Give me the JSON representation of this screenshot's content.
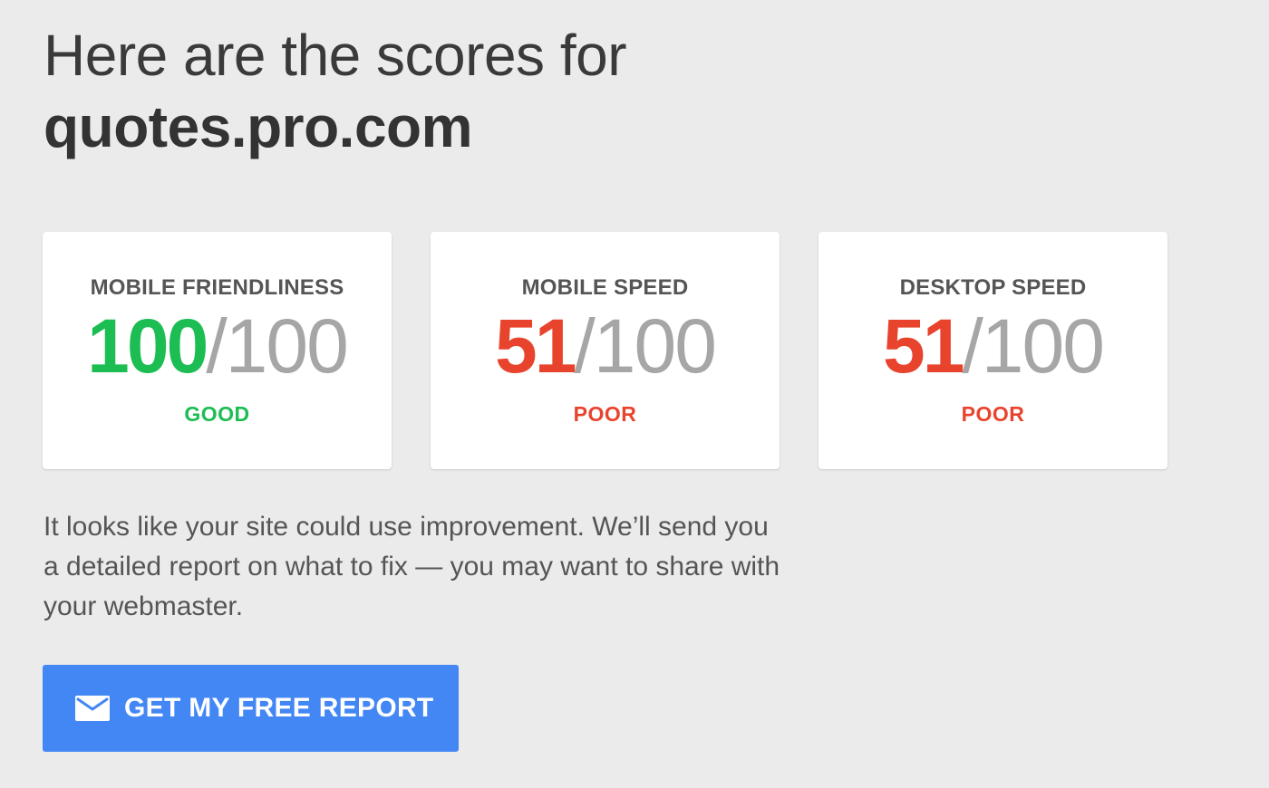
{
  "header": {
    "line1": "Here are the scores for",
    "domain": "quotes.pro.com"
  },
  "colors": {
    "good": "#1cbd52",
    "poor": "#e8432d",
    "accent": "#4387f4"
  },
  "scores": [
    {
      "title": "MOBILE FRIENDLINESS",
      "value": "100",
      "max": "/100",
      "rating": "GOOD",
      "status": "good"
    },
    {
      "title": "MOBILE SPEED",
      "value": "51",
      "max": "/100",
      "rating": "POOR",
      "status": "poor"
    },
    {
      "title": "DESKTOP SPEED",
      "value": "51",
      "max": "/100",
      "rating": "POOR",
      "status": "poor"
    }
  ],
  "message": "It looks like your site could use improvement. We’ll send you a detailed report on what to fix — you may want to share with your webmaster.",
  "cta": {
    "icon": "mail-icon",
    "label": "GET MY FREE REPORT"
  }
}
